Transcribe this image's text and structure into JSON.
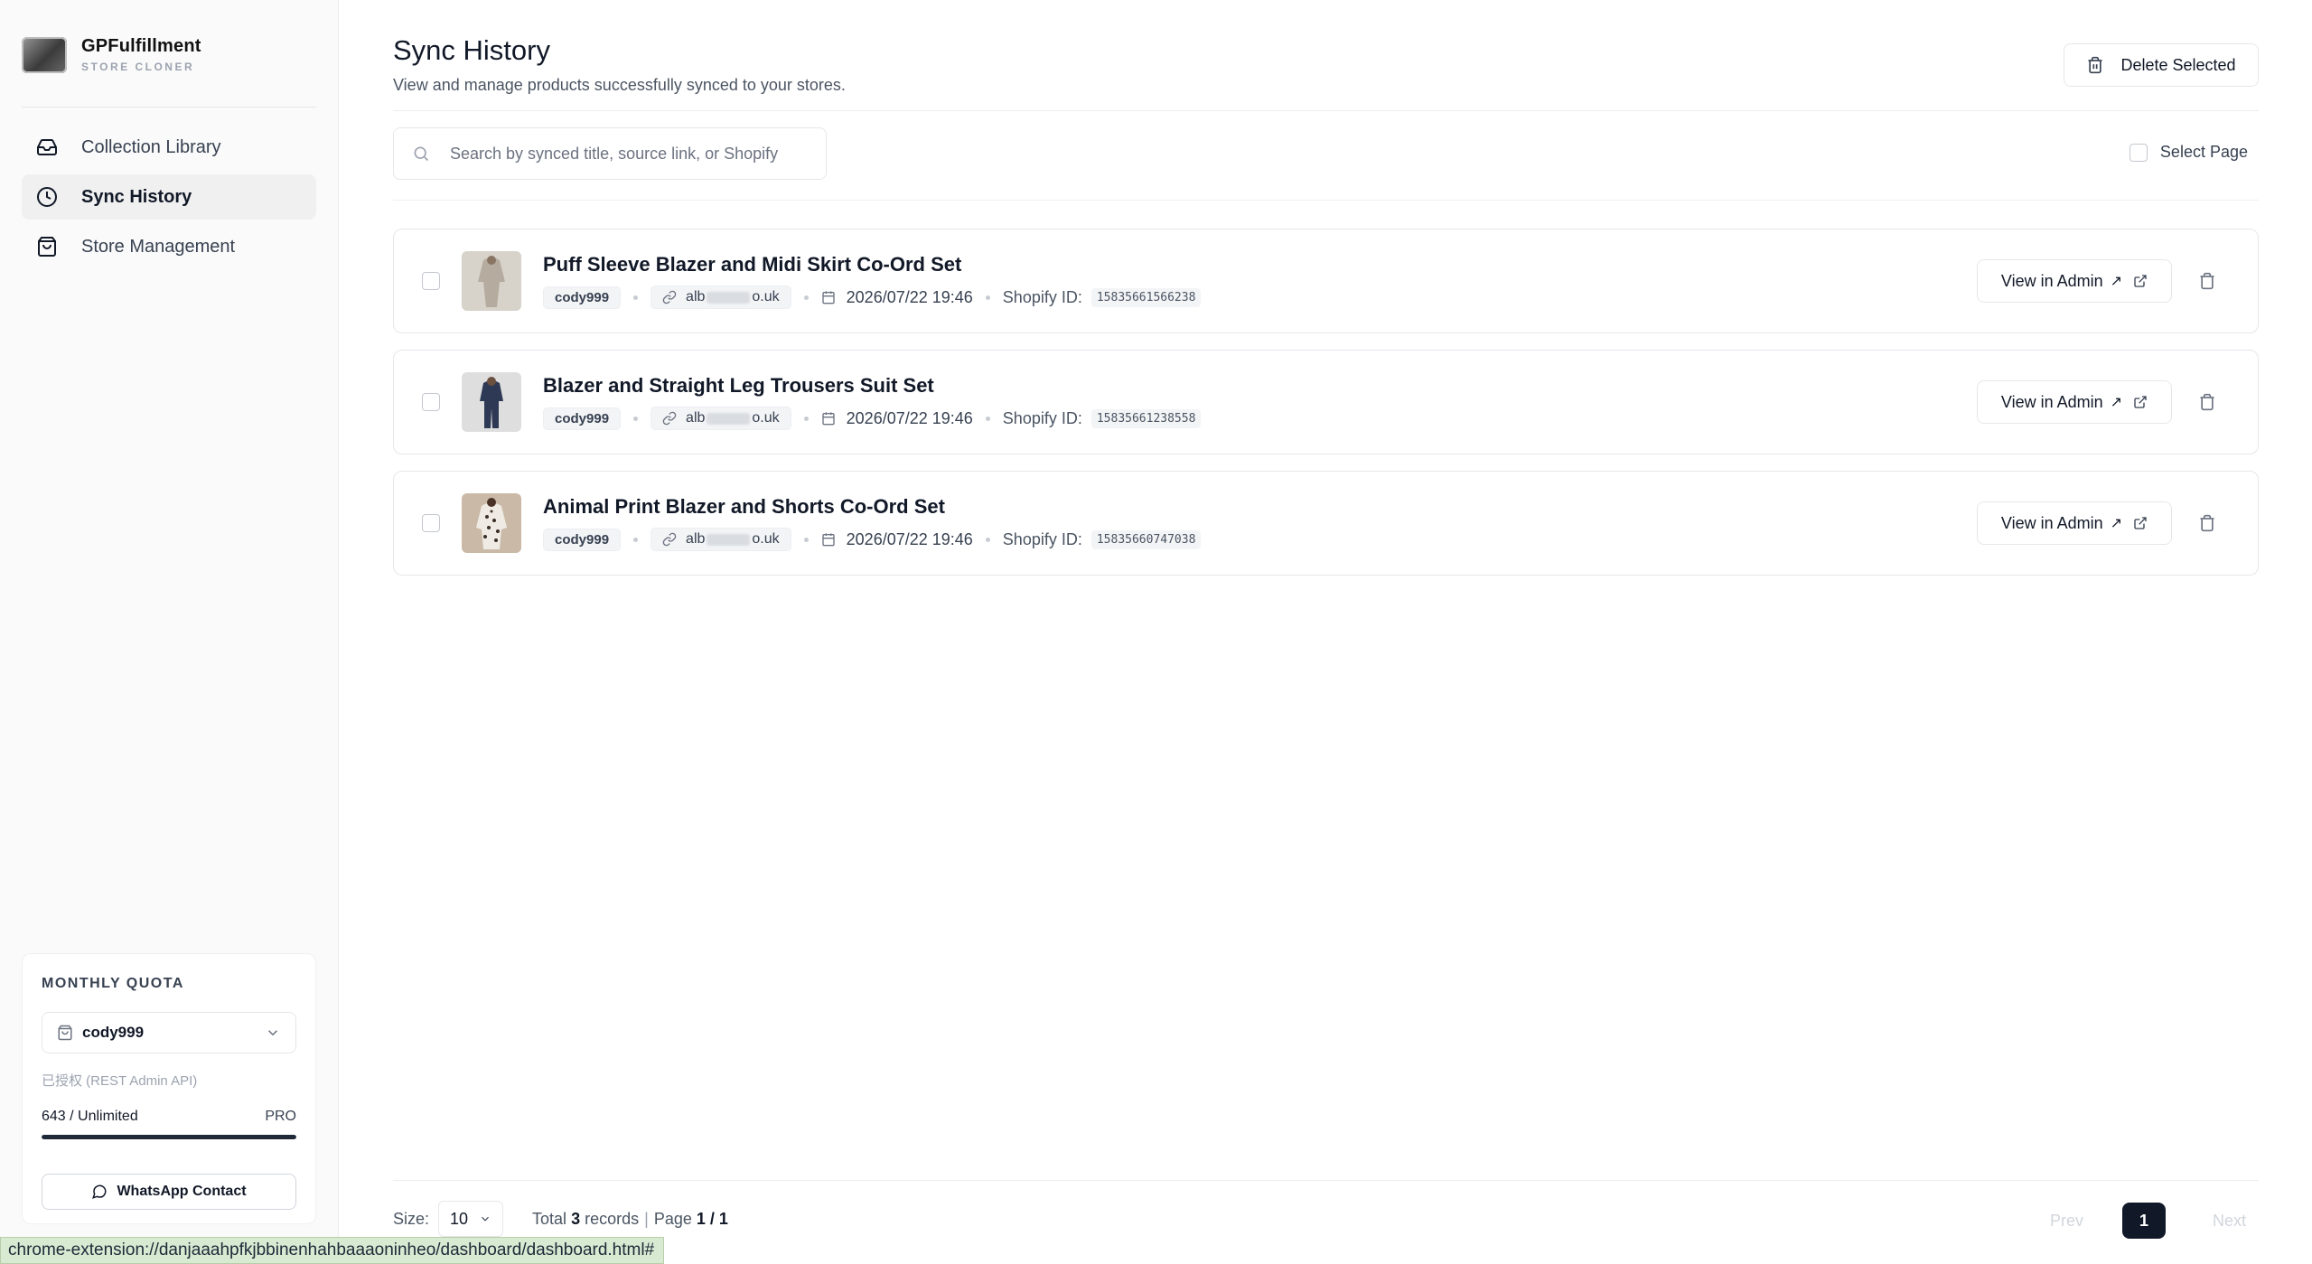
{
  "brand": {
    "name": "GPFulfillment",
    "subtitle": "STORE CLONER"
  },
  "sidebar": {
    "items": [
      {
        "label": "Collection Library",
        "icon": "inbox-icon",
        "active": false
      },
      {
        "label": "Sync History",
        "icon": "clock-icon",
        "active": true
      },
      {
        "label": "Store Management",
        "icon": "shopping-bag-icon",
        "active": false
      }
    ],
    "quota": {
      "title": "MONTHLY QUOTA",
      "store": "cody999",
      "auth_note": "已授权 (REST Admin API)",
      "usage": "643 / Unlimited",
      "plan": "PRO",
      "usage_fraction": 1.0,
      "contact_label": "WhatsApp Contact"
    }
  },
  "header": {
    "title": "Sync History",
    "subtitle": "View and manage products successfully synced to your stores.",
    "delete_selected": "Delete Selected"
  },
  "search": {
    "placeholder": "Search by synced title, source link, or Shopify",
    "select_page": "Select Page"
  },
  "rows": [
    {
      "title": "Puff Sleeve Blazer and Midi Skirt Co-Ord Set",
      "store": "cody999",
      "link_start": "alb",
      "link_end": "o.uk",
      "date": "2026/07/22 19:46",
      "shopify_label": "Shopify ID:",
      "shopify_id": "15835661566238",
      "admin_label": "View in Admin",
      "thumb_colors": [
        "#cfc8bd",
        "#a8a095",
        "#e8e4de"
      ]
    },
    {
      "title": "Blazer and Straight Leg Trousers Suit Set",
      "store": "cody999",
      "link_start": "alb",
      "link_end": "o.uk",
      "date": "2026/07/22 19:46",
      "shopify_label": "Shopify ID:",
      "shopify_id": "15835661238558",
      "admin_label": "View in Admin",
      "thumb_colors": [
        "#2e3a55",
        "#1f2940",
        "#dcdcdc"
      ]
    },
    {
      "title": "Animal Print Blazer and Shorts Co-Ord Set",
      "store": "cody999",
      "link_start": "alb",
      "link_end": "o.uk",
      "date": "2026/07/22 19:46",
      "shopify_label": "Shopify ID:",
      "shopify_id": "15835660747038",
      "admin_label": "View in Admin",
      "thumb_colors": [
        "#e9e4dc",
        "#3a2e26",
        "#c9b9a6"
      ]
    }
  ],
  "pager": {
    "size_label": "Size:",
    "size_value": "10",
    "total_prefix": "Total",
    "total_count": "3",
    "total_suffix": "records",
    "page_label": "Page",
    "page_value": "1 / 1",
    "prev": "Prev",
    "current": "1",
    "next": "Next"
  },
  "status_url": "chrome-extension://danjaaahpfkjbbinenhahbaaaoninheo/dashboard/dashboard.html#"
}
